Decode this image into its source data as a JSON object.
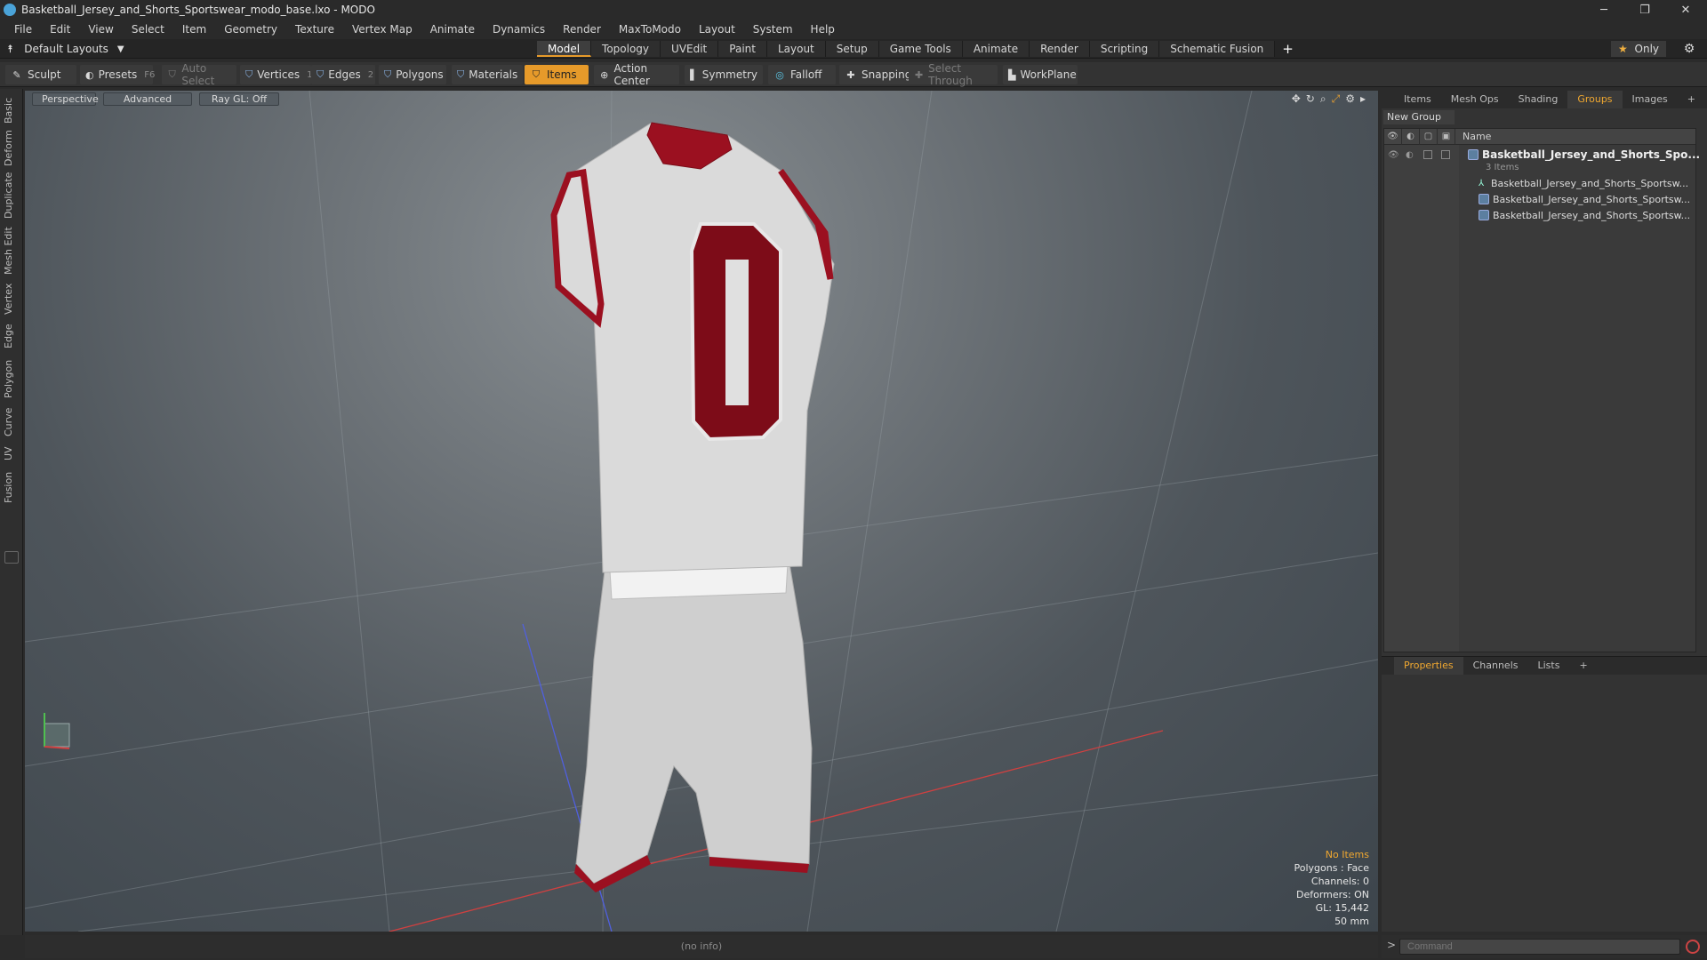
{
  "window": {
    "title": "Basketball_Jersey_and_Shorts_Sportswear_modo_base.lxo - MODO",
    "minimize": "─",
    "maximize": "❐",
    "close": "✕"
  },
  "menu": [
    "File",
    "Edit",
    "View",
    "Select",
    "Item",
    "Geometry",
    "Texture",
    "Vertex Map",
    "Animate",
    "Dynamics",
    "Render",
    "MaxToModo",
    "Layout",
    "System",
    "Help"
  ],
  "layout_selector": "Default Layouts",
  "tabs": [
    "Model",
    "Topology",
    "UVEdit",
    "Paint",
    "Layout",
    "Setup",
    "Game Tools",
    "Animate",
    "Render",
    "Scripting",
    "Schematic Fusion"
  ],
  "active_tab": "Model",
  "only_label": "Only",
  "toolbar": {
    "sculpt": "Sculpt",
    "presets": "Presets",
    "presets_key": "F6",
    "auto_select": "Auto Select",
    "vertices": "Vertices",
    "vertices_count": "1",
    "edges": "Edges",
    "edges_count": "2",
    "polygons": "Polygons",
    "materials": "Materials",
    "items": "Items",
    "action_center": "Action Center",
    "symmetry": "Symmetry",
    "falloff": "Falloff",
    "snapping": "Snapping",
    "select_through": "Select Through",
    "workplane": "WorkPlane"
  },
  "left_tabs": [
    "Basic",
    "Deform",
    "Duplicate",
    "Mesh Edit",
    "Vertex",
    "Edge",
    "Polygon",
    "Curve",
    "UV",
    "Fusion"
  ],
  "viewport": {
    "perspective": "Perspective",
    "advanced": "Advanced",
    "raygl": "Ray GL: Off",
    "jersey_number": "0",
    "stats": {
      "items": "No Items",
      "polygons": "Polygons : Face",
      "channels": "Channels: 0",
      "deformers": "Deformers: ON",
      "gl": "GL: 15,442",
      "focal": "50 mm"
    }
  },
  "status_info": "(no info)",
  "right_panel": {
    "tabs": [
      "Items",
      "Mesh Ops",
      "Shading",
      "Groups",
      "Images"
    ],
    "active_tab": "Groups",
    "new_group": "New Group",
    "name_col": "Name",
    "group_name": "Basketball_Jersey_and_Shorts_Spo...",
    "group_count": "3 Items",
    "children": [
      "Basketball_Jersey_and_Shorts_Sportsw...",
      "Basketball_Jersey_and_Shorts_Sportsw...",
      "Basketball_Jersey_and_Shorts_Sportsw..."
    ]
  },
  "prop_panel": {
    "tabs": [
      "Properties",
      "Channels",
      "Lists"
    ],
    "active_tab": "Properties"
  },
  "command": {
    "prompt": ">",
    "placeholder": "Command"
  },
  "colors": {
    "accent": "#e69a2a",
    "jersey": "#d9d9d9",
    "trim": "#9b1020"
  }
}
